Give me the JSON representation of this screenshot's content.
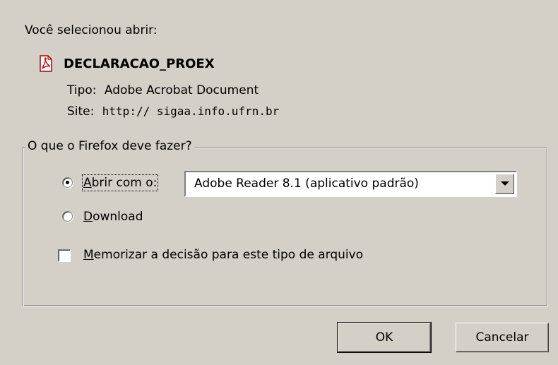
{
  "dialog": {
    "intro": "Você selecionou abrir:",
    "file": {
      "name": "DECLARACAO_PROEX",
      "icon": "pdf-file-icon",
      "type_key": "Tipo:",
      "type_value": "Adobe Acrobat Document",
      "site_key": "Site:",
      "site_value": "http:// sigaa.info.ufrn.br"
    },
    "group": {
      "legend": "O que o Firefox deve fazer?",
      "open_with": {
        "accel": "A",
        "label_rest": "brir com o:",
        "selected": true
      },
      "app_select": {
        "value": "Adobe Reader 8.1 (aplicativo padrão)"
      },
      "download": {
        "accel": "D",
        "label_rest": "ownload",
        "selected": false
      },
      "remember": {
        "accel": "M",
        "label_rest": "emorizar a decisão para este tipo de arquivo",
        "checked": false
      }
    },
    "buttons": {
      "ok": "OK",
      "cancel": "Cancelar"
    }
  }
}
